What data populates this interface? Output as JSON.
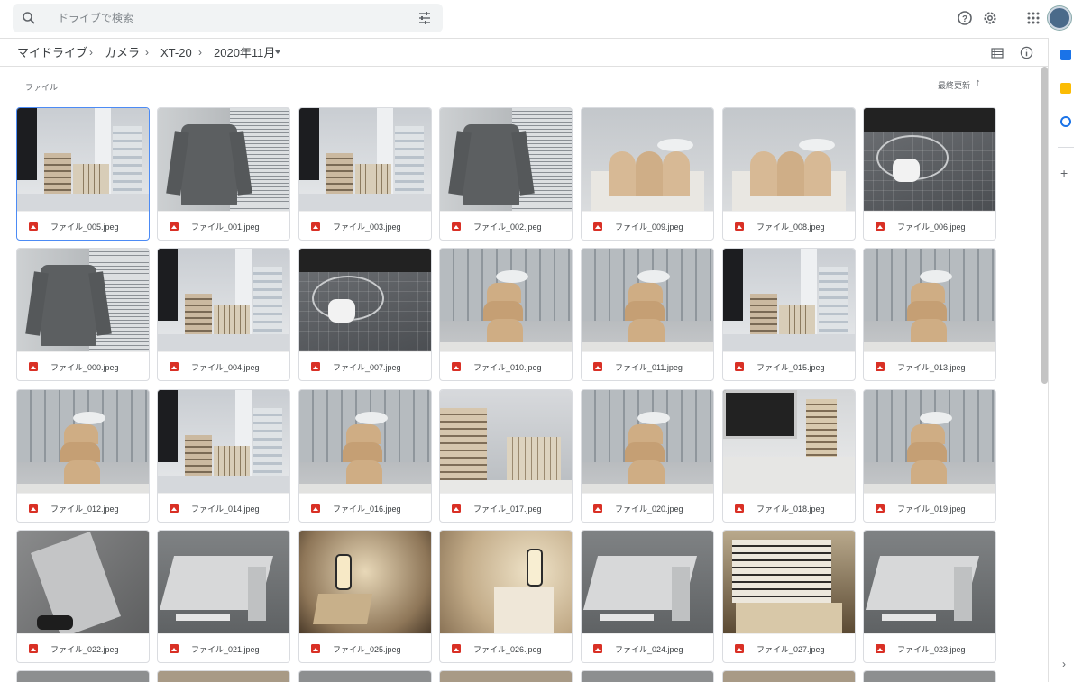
{
  "search": {
    "placeholder": "ドライブで検索"
  },
  "breadcrumb": [
    "マイドライブ",
    "カメラ",
    "XT-20",
    "2020年11月"
  ],
  "section_label": "ファイル",
  "sort_label": "最終更新",
  "colors": {
    "accent": "#4c8bf5",
    "image_icon": "#d93025"
  },
  "files": [
    {
      "name": "ファイル_005.jpeg",
      "scene": "desk"
    },
    {
      "name": "ファイル_001.jpeg",
      "scene": "sweater"
    },
    {
      "name": "ファイル_003.jpeg",
      "scene": "desk"
    },
    {
      "name": "ファイル_002.jpeg",
      "scene": "sweater"
    },
    {
      "name": "ファイル_009.jpeg",
      "scene": "bird"
    },
    {
      "name": "ファイル_008.jpeg",
      "scene": "bird"
    },
    {
      "name": "ファイル_006.jpeg",
      "scene": "airpods"
    },
    {
      "name": "ファイル_000.jpeg",
      "scene": "sweater"
    },
    {
      "name": "ファイル_004.jpeg",
      "scene": "desk"
    },
    {
      "name": "ファイル_007.jpeg",
      "scene": "airpods"
    },
    {
      "name": "ファイル_010.jpeg",
      "scene": "cloud"
    },
    {
      "name": "ファイル_011.jpeg",
      "scene": "cloud"
    },
    {
      "name": "ファイル_015.jpeg",
      "scene": "desk"
    },
    {
      "name": "ファイル_013.jpeg",
      "scene": "cloud"
    },
    {
      "name": "ファイル_012.jpeg",
      "scene": "cloud"
    },
    {
      "name": "ファイル_014.jpeg",
      "scene": "desk"
    },
    {
      "name": "ファイル_016.jpeg",
      "scene": "cloud"
    },
    {
      "name": "ファイル_017.jpeg",
      "scene": "books"
    },
    {
      "name": "ファイル_020.jpeg",
      "scene": "cloud"
    },
    {
      "name": "ファイル_018.jpeg",
      "scene": "imac"
    },
    {
      "name": "ファイル_019.jpeg",
      "scene": "cloud"
    },
    {
      "name": "ファイル_022.jpeg",
      "scene": "floor"
    },
    {
      "name": "ファイル_021.jpeg",
      "scene": "shelfkit"
    },
    {
      "name": "ファイル_025.jpeg",
      "scene": "lantern"
    },
    {
      "name": "ファイル_026.jpeg",
      "scene": "lantern2"
    },
    {
      "name": "ファイル_024.jpeg",
      "scene": "shelfkit"
    },
    {
      "name": "ファイル_027.jpeg",
      "scene": "bookstack"
    },
    {
      "name": "ファイル_023.jpeg",
      "scene": "shelfkit"
    }
  ]
}
